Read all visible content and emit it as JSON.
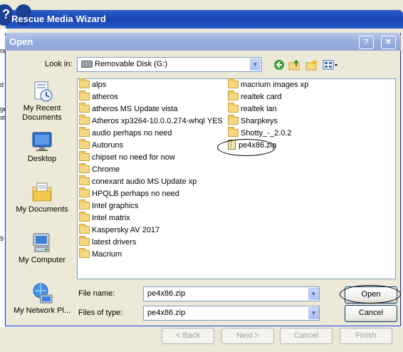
{
  "wizard": {
    "title": "Rescue Media Wizard",
    "left_fragments": [
      "og",
      "d",
      "ge",
      "st",
      "9"
    ],
    "nav": {
      "back": "< Back",
      "next": "Next >",
      "cancel": "Cancel",
      "finish": "Finish"
    }
  },
  "dialog": {
    "title": "Open",
    "help_button": "?",
    "close_button": "✕",
    "look_in_label": "Look in:",
    "look_in_value": "Removable Disk (G:)",
    "places": [
      {
        "label": "My Recent Documents",
        "icon": "recent-documents-icon"
      },
      {
        "label": "Desktop",
        "icon": "desktop-icon"
      },
      {
        "label": "My Documents",
        "icon": "my-documents-icon"
      },
      {
        "label": "My Computer",
        "icon": "my-computer-icon"
      },
      {
        "label": "My Network Pl...",
        "icon": "my-network-icon"
      }
    ],
    "files_col1": [
      "alps",
      "atheros",
      "atheros MS Update vista",
      "Atheros xp3264-10.0.0.274-whql YES",
      "audio perhaps no need",
      "Autoruns",
      "chipset no need for now",
      "Chrome",
      "conexant audio MS Update xp",
      "HPQLB perhaps no need",
      "Intel graphics",
      "Intel matrix",
      "Kaspersky AV 2017",
      "latest drivers",
      "Macrium"
    ],
    "files_col2": [
      "macrium images xp",
      "realtek card",
      "realtek lan",
      "Sharpkeys",
      "Shotty_-_2.0.2"
    ],
    "zip_file": "pe4x86.zip",
    "file_name_label": "File name:",
    "file_name_value": "pe4x86.zip",
    "file_type_label": "Files of type:",
    "file_type_value": "pe4x86.zip",
    "open_button": "Open",
    "cancel_button": "Cancel"
  }
}
